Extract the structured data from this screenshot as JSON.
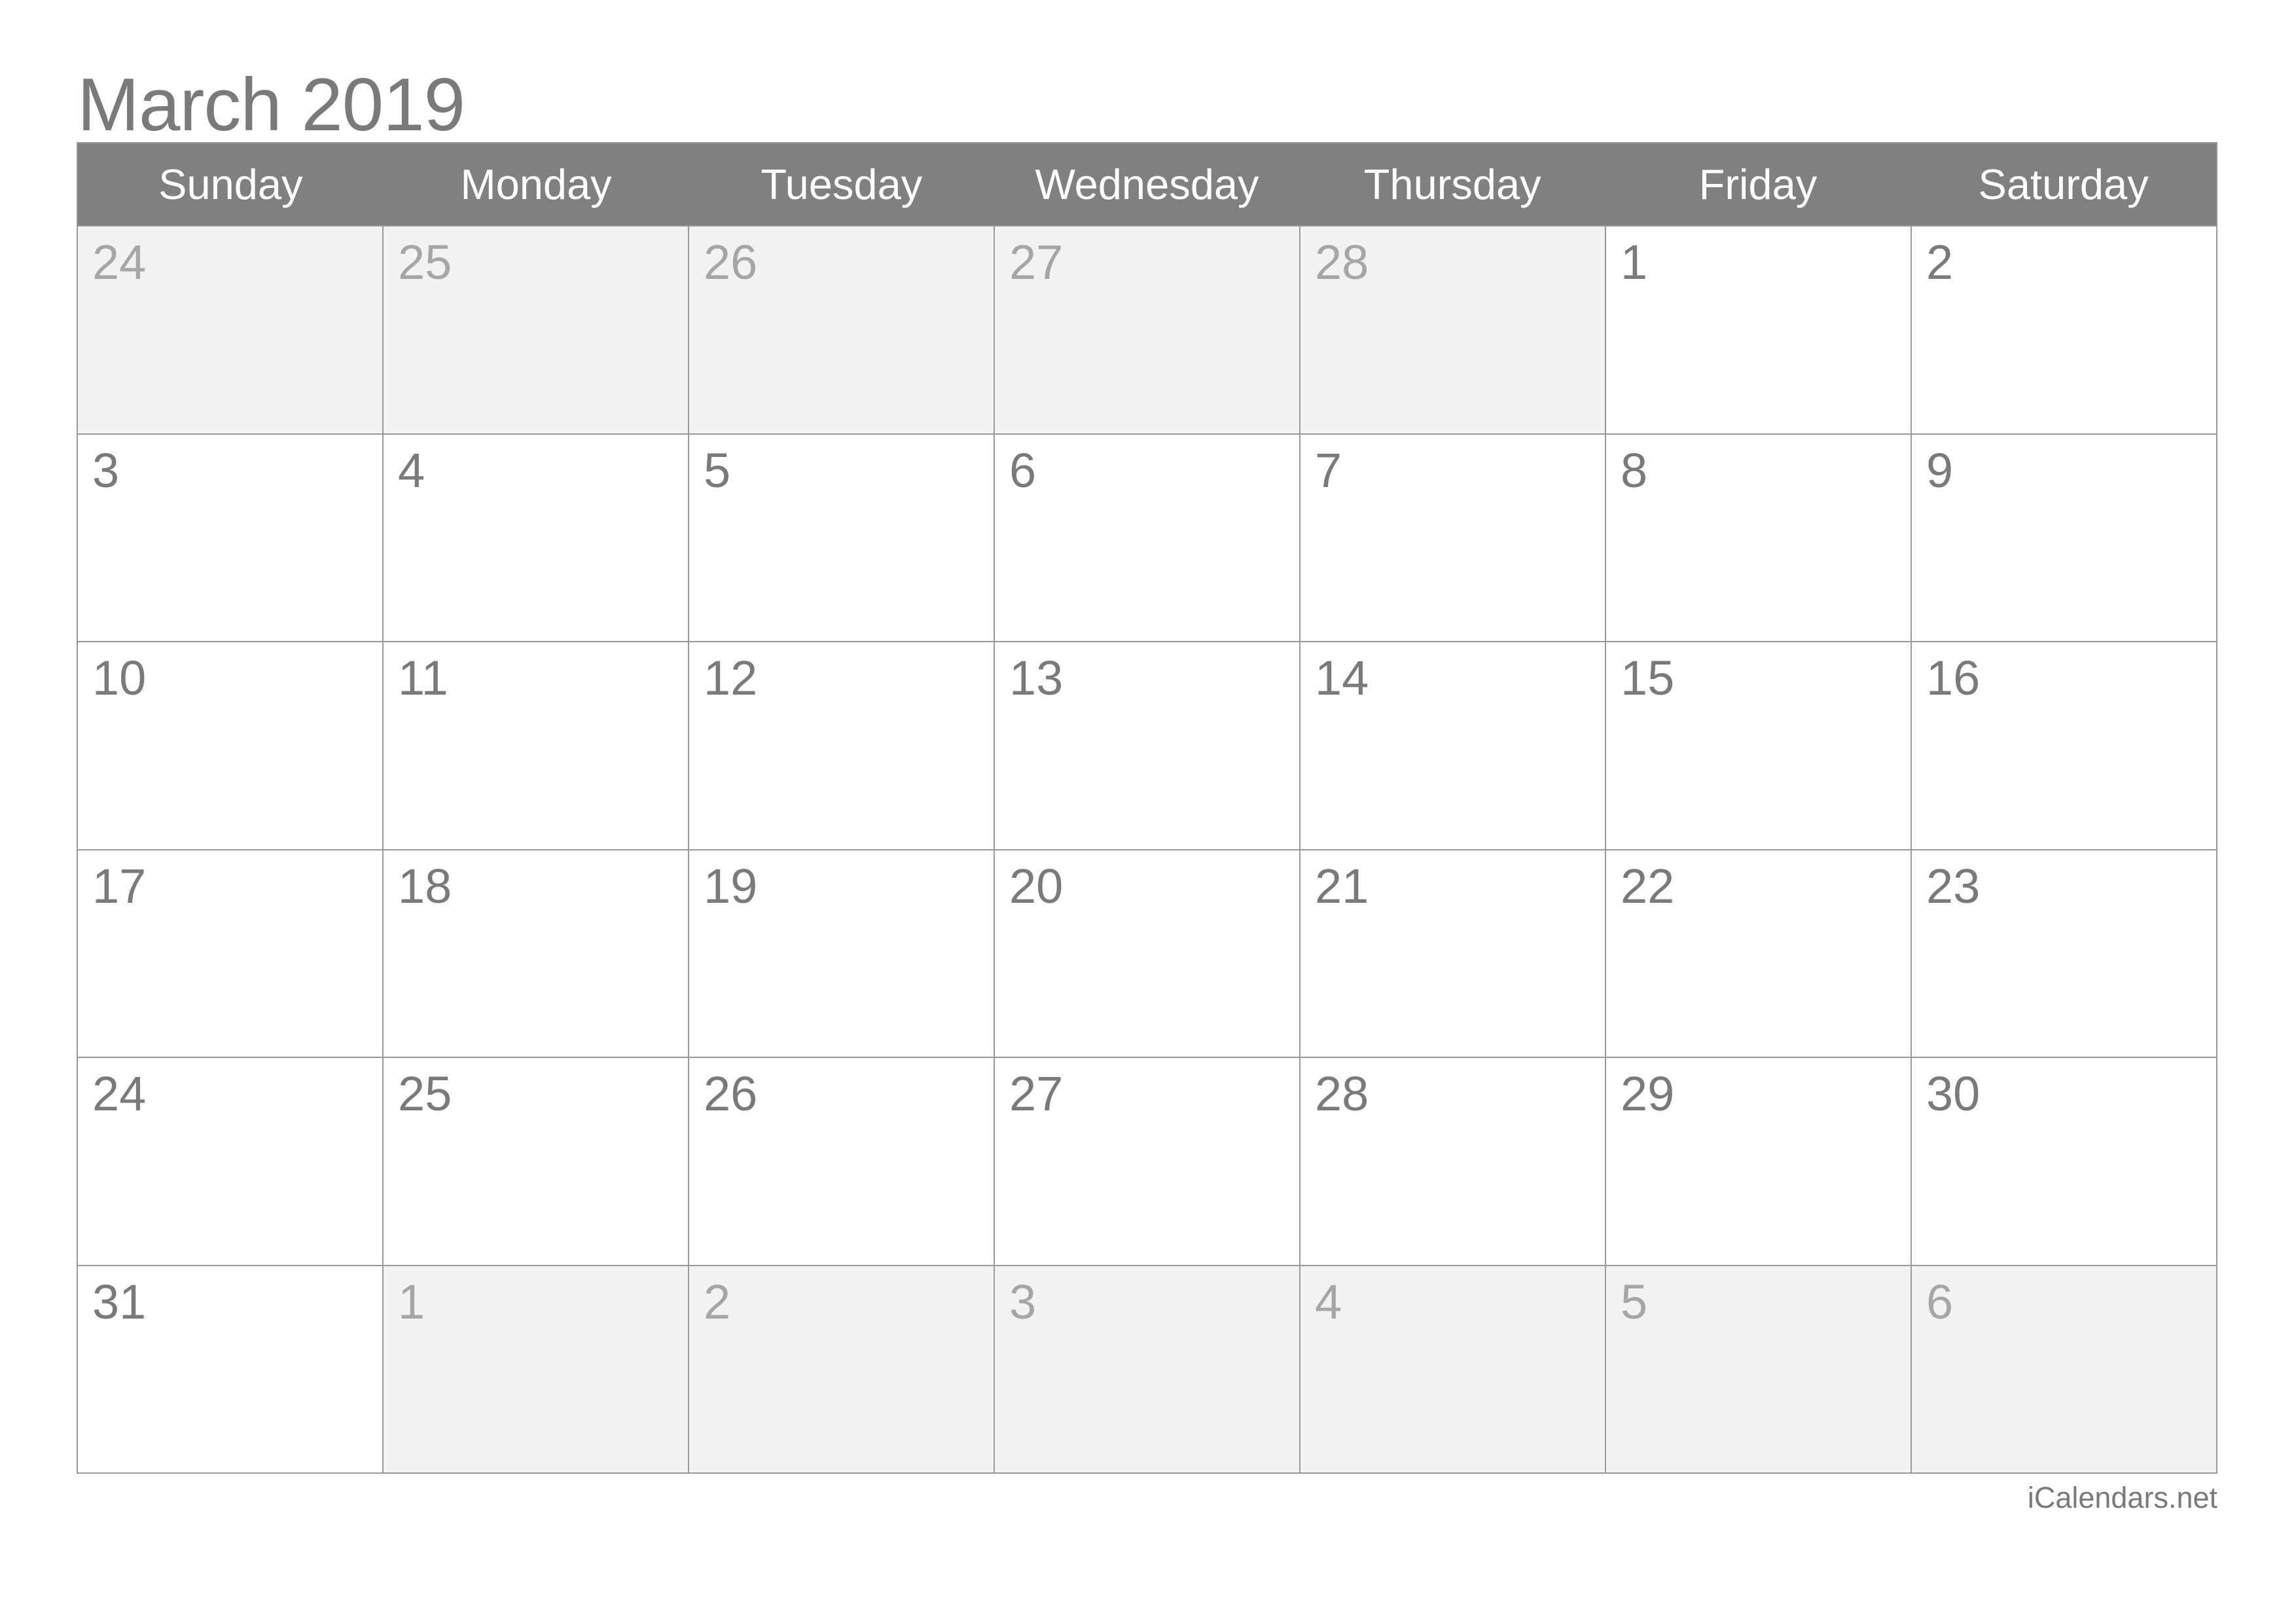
{
  "title": "March 2019",
  "weekdays": [
    "Sunday",
    "Monday",
    "Tuesday",
    "Wednesday",
    "Thursday",
    "Friday",
    "Saturday"
  ],
  "weeks": [
    [
      {
        "day": "24",
        "in_month": false
      },
      {
        "day": "25",
        "in_month": false
      },
      {
        "day": "26",
        "in_month": false
      },
      {
        "day": "27",
        "in_month": false
      },
      {
        "day": "28",
        "in_month": false
      },
      {
        "day": "1",
        "in_month": true
      },
      {
        "day": "2",
        "in_month": true
      }
    ],
    [
      {
        "day": "3",
        "in_month": true
      },
      {
        "day": "4",
        "in_month": true
      },
      {
        "day": "5",
        "in_month": true
      },
      {
        "day": "6",
        "in_month": true
      },
      {
        "day": "7",
        "in_month": true
      },
      {
        "day": "8",
        "in_month": true
      },
      {
        "day": "9",
        "in_month": true
      }
    ],
    [
      {
        "day": "10",
        "in_month": true
      },
      {
        "day": "11",
        "in_month": true
      },
      {
        "day": "12",
        "in_month": true
      },
      {
        "day": "13",
        "in_month": true
      },
      {
        "day": "14",
        "in_month": true
      },
      {
        "day": "15",
        "in_month": true
      },
      {
        "day": "16",
        "in_month": true
      }
    ],
    [
      {
        "day": "17",
        "in_month": true
      },
      {
        "day": "18",
        "in_month": true
      },
      {
        "day": "19",
        "in_month": true
      },
      {
        "day": "20",
        "in_month": true
      },
      {
        "day": "21",
        "in_month": true
      },
      {
        "day": "22",
        "in_month": true
      },
      {
        "day": "23",
        "in_month": true
      }
    ],
    [
      {
        "day": "24",
        "in_month": true
      },
      {
        "day": "25",
        "in_month": true
      },
      {
        "day": "26",
        "in_month": true
      },
      {
        "day": "27",
        "in_month": true
      },
      {
        "day": "28",
        "in_month": true
      },
      {
        "day": "29",
        "in_month": true
      },
      {
        "day": "30",
        "in_month": true
      }
    ],
    [
      {
        "day": "31",
        "in_month": true
      },
      {
        "day": "1",
        "in_month": false
      },
      {
        "day": "2",
        "in_month": false
      },
      {
        "day": "3",
        "in_month": false
      },
      {
        "day": "4",
        "in_month": false
      },
      {
        "day": "5",
        "in_month": false
      },
      {
        "day": "6",
        "in_month": false
      }
    ]
  ],
  "footer": "iCalendars.net",
  "colors": {
    "header_bg": "#808080",
    "header_text": "#ffffff",
    "text": "#7a7a7a",
    "muted_text": "#a6a6a6",
    "muted_bg": "#f2f2f2",
    "border": "#999999"
  }
}
